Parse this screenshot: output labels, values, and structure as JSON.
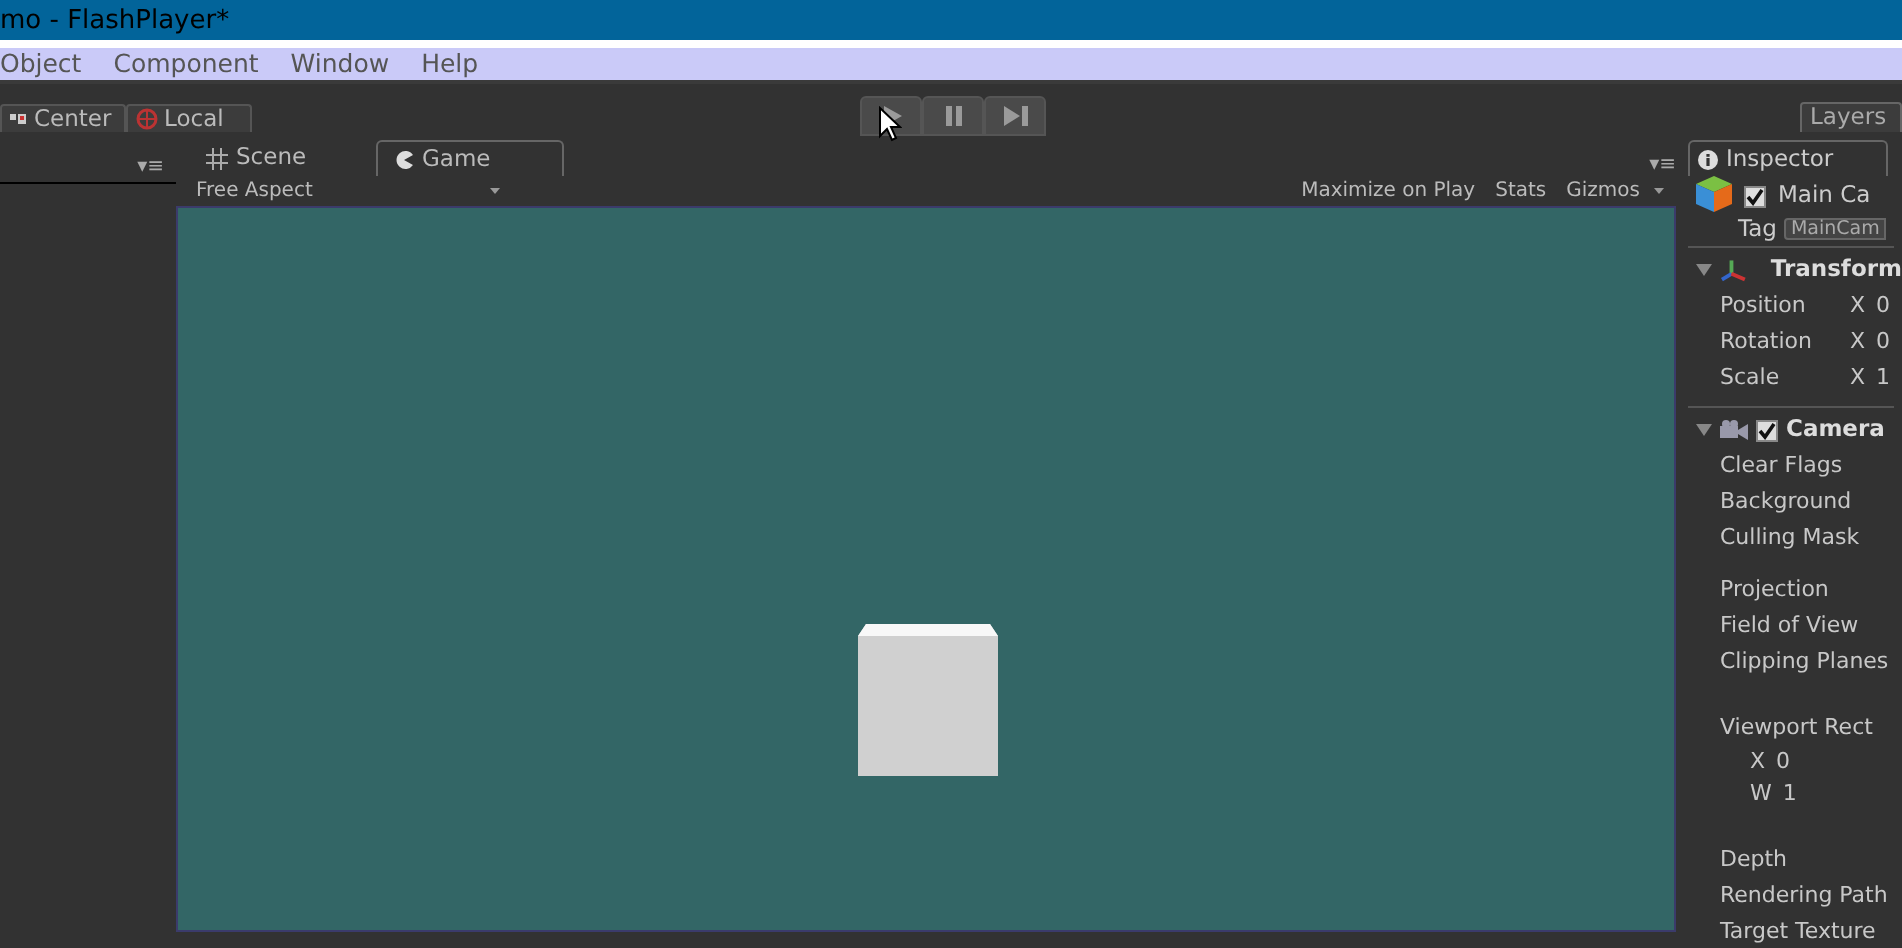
{
  "window": {
    "title": "mo - FlashPlayer*"
  },
  "menu": [
    "Object",
    "Component",
    "Window",
    "Help"
  ],
  "hierarchy_panel": {
    "menu_glyph": "▾≡"
  },
  "view_panel": {
    "menu_glyph": "▾≡"
  },
  "toolbar": {
    "pivot_buttons": [
      {
        "label": "Center",
        "kind": "center"
      },
      {
        "label": "Local",
        "kind": "local"
      }
    ],
    "playback": [
      {
        "kind": "play",
        "selected": false
      },
      {
        "kind": "pause",
        "selected": false
      },
      {
        "kind": "step",
        "selected": false
      }
    ],
    "layers": "Layers"
  },
  "view_tabs": [
    {
      "label": "Scene",
      "kind": "scene",
      "selected": false
    },
    {
      "label": "Game",
      "kind": "game",
      "selected": true
    }
  ],
  "game_bar": {
    "aspect": "Free Aspect",
    "options": [
      {
        "label": "Maximize on Play",
        "selected": false
      },
      {
        "label": "Stats",
        "selected": false
      },
      {
        "label": "Gizmos",
        "selected": false
      }
    ]
  },
  "inspector": {
    "tab": "Inspector",
    "object_name": "Main Ca",
    "object_active": true,
    "tag_label": "Tag",
    "tag_value": "MainCam",
    "components": [
      {
        "name": "Transform",
        "kind": "transform",
        "expanded": true,
        "properties": [
          {
            "label": "Position",
            "value": "X 0",
            "kind": "field",
            "gap_before": false
          },
          {
            "label": "Rotation",
            "value": "X 0",
            "kind": "field",
            "gap_before": false
          },
          {
            "label": "Scale",
            "value": "X 1",
            "kind": "field",
            "gap_before": false
          }
        ]
      },
      {
        "name": "Camera",
        "kind": "camera",
        "expanded": true,
        "enabled": true,
        "properties": [
          {
            "label": "Clear Flags",
            "kind": "field",
            "gap_before": false
          },
          {
            "label": "Background",
            "kind": "field",
            "gap_before": false
          },
          {
            "label": "Culling Mask",
            "kind": "field",
            "gap_before": false
          },
          {
            "label": "Projection",
            "kind": "field",
            "gap_before": true
          },
          {
            "label": "Field of View",
            "kind": "field",
            "gap_before": false
          },
          {
            "label": "Clipping Planes",
            "kind": "field",
            "gap_before": false
          },
          {
            "label": "Viewport Rect",
            "kind": "field",
            "gap_before": true
          },
          {
            "label": "X 0",
            "kind": "sub",
            "gap_before": false
          },
          {
            "label": "W 1",
            "kind": "sub",
            "gap_before": false
          },
          {
            "label": "Depth",
            "kind": "field",
            "gap_before": true
          },
          {
            "label": "Rendering Path",
            "kind": "field",
            "gap_before": false
          },
          {
            "label": "Target Texture",
            "kind": "field",
            "gap_before": false
          }
        ]
      }
    ]
  }
}
